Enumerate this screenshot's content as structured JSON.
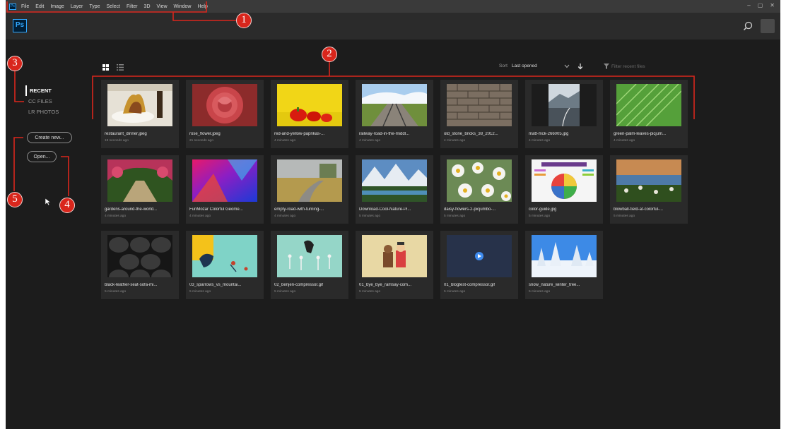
{
  "menubar": {
    "app_icon": "Ps",
    "items": [
      "File",
      "Edit",
      "Image",
      "Layer",
      "Type",
      "Select",
      "Filter",
      "3D",
      "View",
      "Window",
      "Help"
    ],
    "controls": [
      "–",
      "▢",
      "✕"
    ]
  },
  "appbar": {
    "logo_text": "Ps",
    "search_icon": "search-icon"
  },
  "sidebar": {
    "nav": [
      {
        "label": "RECENT",
        "active": true
      },
      {
        "label": "CC FILES",
        "active": false
      },
      {
        "label": "LR PHOTOS",
        "active": false
      }
    ],
    "create_label": "Create new...",
    "open_label": "Open..."
  },
  "toolbar": {
    "sort_label": "Sort",
    "sort_value": "Last opened",
    "filter_placeholder": "Filter recent files"
  },
  "files": [
    {
      "name": "restaurant_dinner.jpeg",
      "time": "19 seconds ago",
      "thumb": "dinner"
    },
    {
      "name": "rose_flower.jpeg",
      "time": "21 seconds ago",
      "thumb": "rose"
    },
    {
      "name": "red-and-yellow-paprikas-...",
      "time": "4 minutes ago",
      "thumb": "paprika"
    },
    {
      "name": "railway-road-in-the-middl...",
      "time": "4 minutes ago",
      "thumb": "railway"
    },
    {
      "name": "old_stone_bricks_38_2012...",
      "time": "4 minutes ago",
      "thumb": "bricks"
    },
    {
      "name": "matt-mck-266005.jpg",
      "time": "4 minutes ago",
      "thumb": "road"
    },
    {
      "name": "green-palm-leaves-picjum...",
      "time": "4 minutes ago",
      "thumb": "palm"
    },
    {
      "name": "gardens-around-the-world...",
      "time": "4 minutes ago",
      "thumb": "garden"
    },
    {
      "name": "FunMozar Colorful Geome...",
      "time": "4 minutes ago",
      "thumb": "geometric"
    },
    {
      "name": "empty-road-with-turning-...",
      "time": "4 minutes ago",
      "thumb": "emptyroad"
    },
    {
      "name": "Download-Cool-Nature-Pi...",
      "time": "5 minutes ago",
      "thumb": "nature"
    },
    {
      "name": "daisy-flowers-2-picjumbo-...",
      "time": "5 minutes ago",
      "thumb": "daisy"
    },
    {
      "name": "color-guide.jpg",
      "time": "5 minutes ago",
      "thumb": "colorguide"
    },
    {
      "name": "blowball-field-at-colorful-...",
      "time": "5 minutes ago",
      "thumb": "blowball"
    },
    {
      "name": "black-leather-seat-sofa-mi...",
      "time": "5 minutes ago",
      "thumb": "leather"
    },
    {
      "name": "03_sparrows_vs_mountai...",
      "time": "5 minutes ago",
      "thumb": "sparrows"
    },
    {
      "name": "02_benjen-compressor.gif",
      "time": "5 minutes ago",
      "thumb": "benjen"
    },
    {
      "name": "01_bye_bye_ramsay-com...",
      "time": "5 minutes ago",
      "thumb": "ramsay"
    },
    {
      "name": "01_blogtest-compressor.gif",
      "time": "5 minutes ago",
      "thumb": "blogtest"
    },
    {
      "name": "snow_nature_winter_tree...",
      "time": "5 minutes ago",
      "thumb": "snow"
    }
  ],
  "annotations": [
    "1",
    "2",
    "3",
    "4",
    "5"
  ],
  "colors": {
    "annotation": "#d9261c",
    "ps_blue": "#31a8ff",
    "panel": "#2a2a2a",
    "bg": "#1c1c1c"
  }
}
